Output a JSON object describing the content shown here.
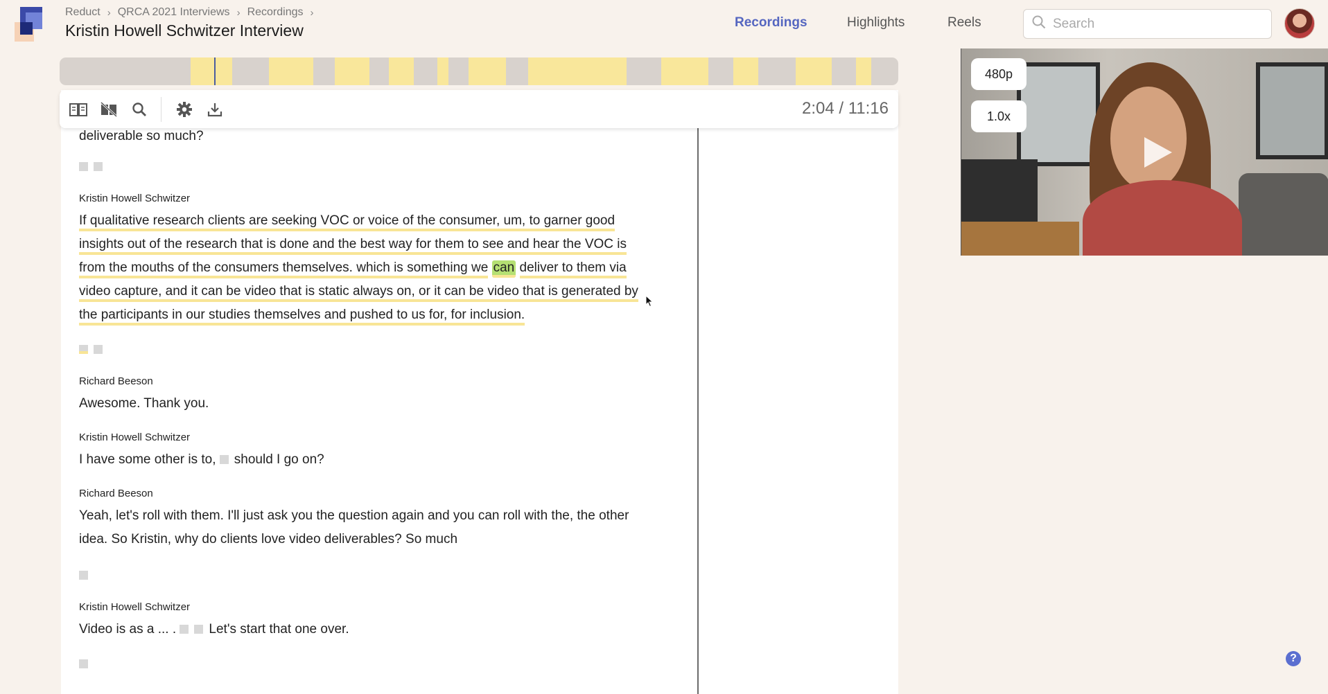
{
  "breadcrumb": {
    "items": [
      {
        "label": "Reduct"
      },
      {
        "label": "QRCA 2021 Interviews"
      },
      {
        "label": "Recordings"
      }
    ]
  },
  "page_title": "Kristin Howell Schwitzer Interview",
  "nav": {
    "recordings": "Recordings",
    "highlights": "Highlights",
    "reels": "Reels"
  },
  "search": {
    "placeholder": "Search",
    "value": ""
  },
  "toolbar": {
    "icons": [
      "book-icon",
      "hide-icon",
      "search-icon",
      "gear-icon",
      "download-icon"
    ],
    "timecode": "2:04 / 11:16"
  },
  "video": {
    "quality": "480p",
    "speed": "1.0x"
  },
  "transcript": {
    "fragment": "deliverable so much?",
    "blocks": [
      {
        "speaker": "Kristin Howell Schwitzer",
        "lines": [
          "If qualitative research clients are seeking VOC or voice of the consumer, um, to garner good",
          "insights out of the research that is done and the best way for them to see and hear the VOC is",
          "from the mouths of the consumers themselves. which is something we",
          "can",
          "deliver to them via",
          "video capture, and it can be video that is static always on, or it can be video that is generated by",
          "the participants in our studies themselves and pushed to us for, for inclusion."
        ]
      },
      {
        "speaker": "Richard Beeson",
        "text": "Awesome. Thank you."
      },
      {
        "speaker": "Kristin Howell Schwitzer",
        "text_before": "I have some other is to,",
        "text_after": "should I go on?"
      },
      {
        "speaker": "Richard Beeson",
        "lines": [
          "Yeah, let's roll with them. I'll just ask you the question again and you can roll with the, the other",
          "idea. So Kristin, why do clients love video deliverables? So much"
        ]
      },
      {
        "speaker": "Kristin Howell Schwitzer",
        "text_before": "Video is as a  ... .",
        "text_after": "Let's start that one over."
      }
    ]
  },
  "help": {
    "label": "?"
  },
  "colors": {
    "accent": "#5566c0",
    "highlight": "#f9e79b",
    "word_active": "#b5e073",
    "background": "#f8f2ec"
  }
}
